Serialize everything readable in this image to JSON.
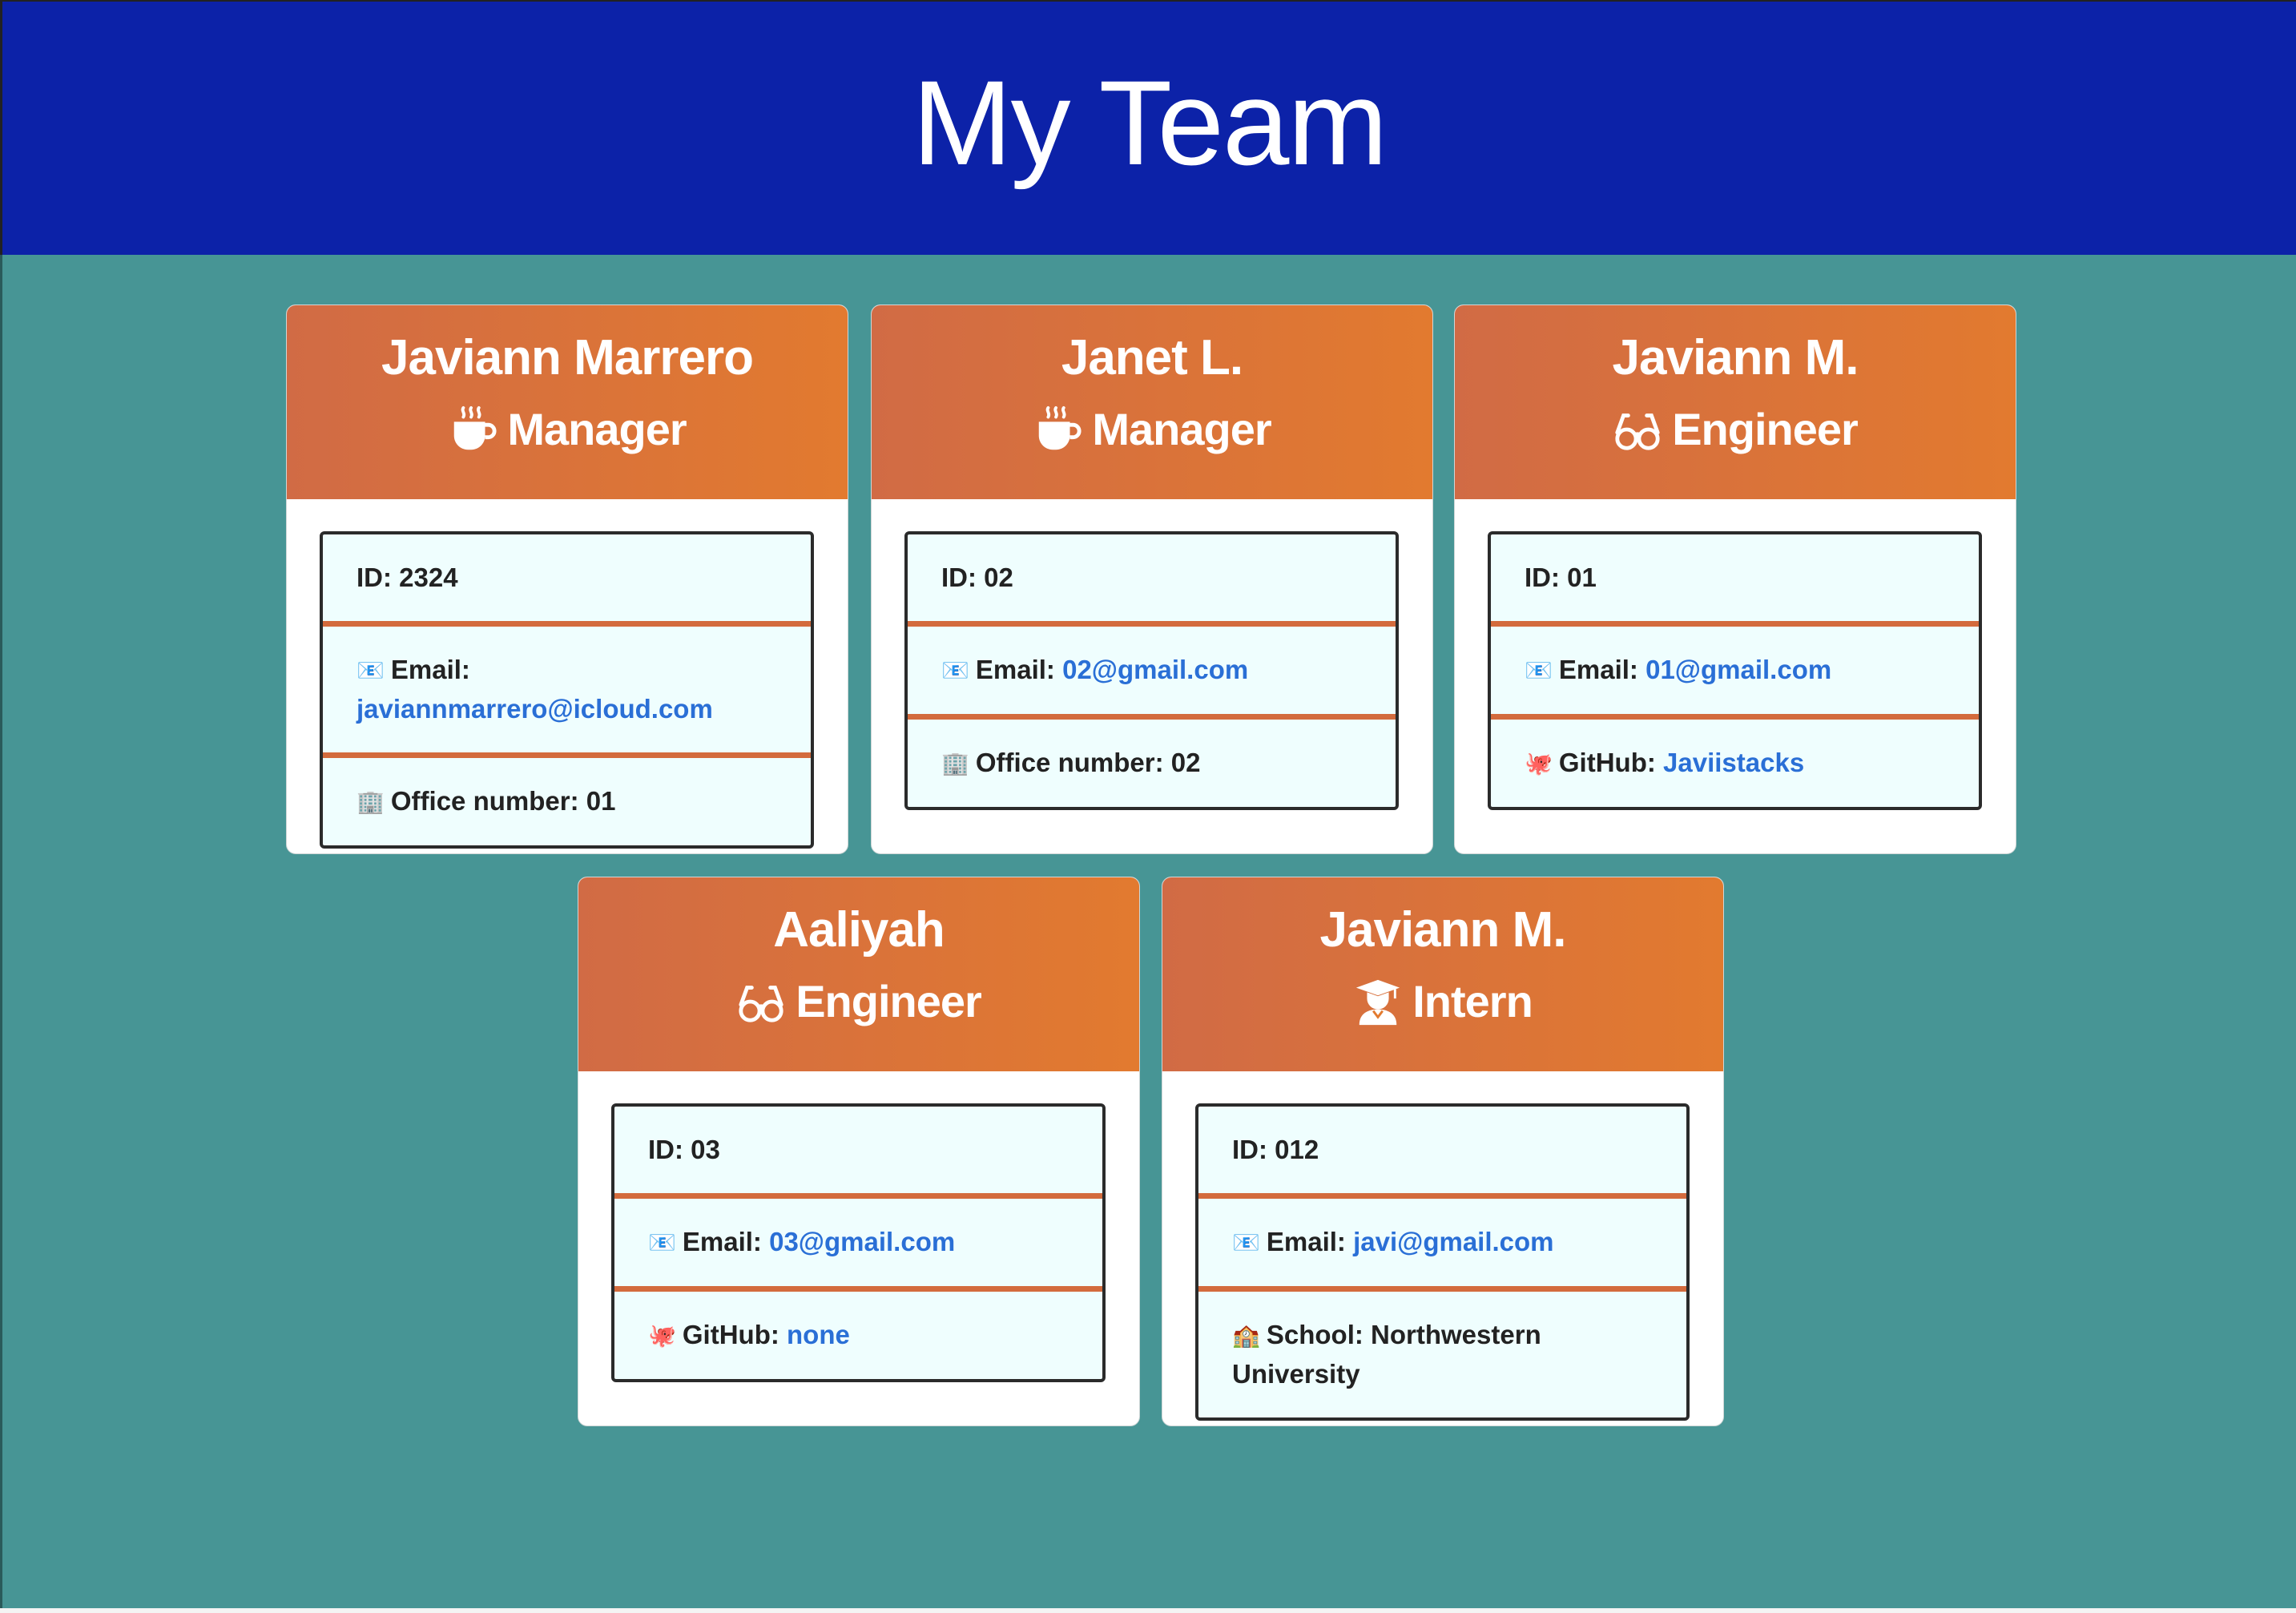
{
  "page": {
    "title": "My Team"
  },
  "cards": [
    {
      "name": "Javiann Marrero",
      "role": "Manager",
      "role_icon": "coffee-icon",
      "id_label": "ID: 2324",
      "email_label": "Email:",
      "email": "javiannmarrero@icloud.com",
      "extra_icon": "🏢",
      "extra_label": "Office number: 01",
      "extra_link": ""
    },
    {
      "name": "Janet L.",
      "role": "Manager",
      "role_icon": "coffee-icon",
      "id_label": "ID: 02",
      "email_label": "Email:",
      "email": "02@gmail.com",
      "extra_icon": "🏢",
      "extra_label": "Office number: 02",
      "extra_link": ""
    },
    {
      "name": "Javiann M.",
      "role": "Engineer",
      "role_icon": "glasses-icon",
      "id_label": "ID: 01",
      "email_label": "Email:",
      "email": "01@gmail.com",
      "extra_icon": "🐙",
      "extra_label": "GitHub:",
      "extra_link": "Javiistacks"
    },
    {
      "name": "Aaliyah",
      "role": "Engineer",
      "role_icon": "glasses-icon",
      "id_label": "ID: 03",
      "email_label": "Email:",
      "email": "03@gmail.com",
      "extra_icon": "🐙",
      "extra_label": "GitHub:",
      "extra_link": "none"
    },
    {
      "name": "Javiann M.",
      "role": "Intern",
      "role_icon": "graduate-icon",
      "id_label": "ID: 012",
      "email_label": "Email:",
      "email": "javi@gmail.com",
      "extra_icon": "🏫",
      "extra_label": "School: Northwestern University",
      "extra_link": ""
    }
  ],
  "colors": {
    "header": "#0c22a8",
    "background": "#479595",
    "card_header": "#e27a2f",
    "link": "#2a6fd6"
  }
}
